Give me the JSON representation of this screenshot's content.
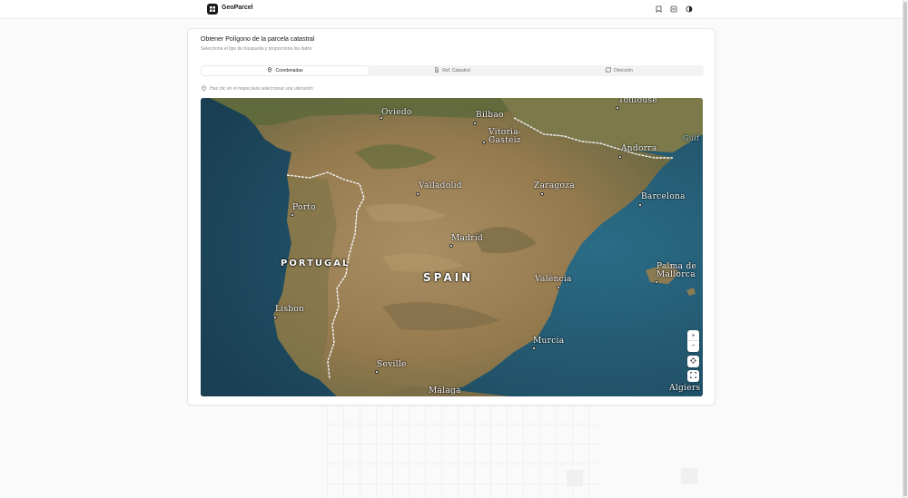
{
  "app": {
    "brand": "GeoParcel"
  },
  "header_icons": [
    {
      "name": "bookmark-icon"
    },
    {
      "name": "list-icon"
    },
    {
      "name": "theme-toggle-icon"
    }
  ],
  "card": {
    "title": "Obtener Polígono de la parcela catastral",
    "subtitle": "Selecciona el tipo de búsqueda y proporciona los datos"
  },
  "tabs": [
    {
      "label": "Coordenadas",
      "icon": "map-pin-icon",
      "active": true
    },
    {
      "label": "Ref. Catastral",
      "icon": "document-icon",
      "active": false
    },
    {
      "label": "Dirección",
      "icon": "map-icon",
      "active": false
    }
  ],
  "hint": "Haz clic en el mapa para seleccionar una ubicación",
  "map": {
    "cities": [
      "Toulouse",
      "Oviedo",
      "Bilbao",
      "Vitoria-",
      "Gasteiz",
      "Andorra",
      "Valladolid",
      "Zaragoza",
      "Barcelona",
      "Porto",
      "Madrid",
      "Palma de",
      "Mallorca",
      "València",
      "Lisbon",
      "Murcia",
      "Seville",
      "Málaga",
      "Algiers",
      "Gulf"
    ],
    "countries": [
      "PORTUGAL",
      "SPAIN"
    ],
    "controls": {
      "zoom_in": "+",
      "zoom_out": "−"
    }
  },
  "colors": {
    "accent": "#18181b",
    "sea": "#1f4a5e",
    "land": "#9c8458",
    "border_line": "#f4f4f4"
  }
}
